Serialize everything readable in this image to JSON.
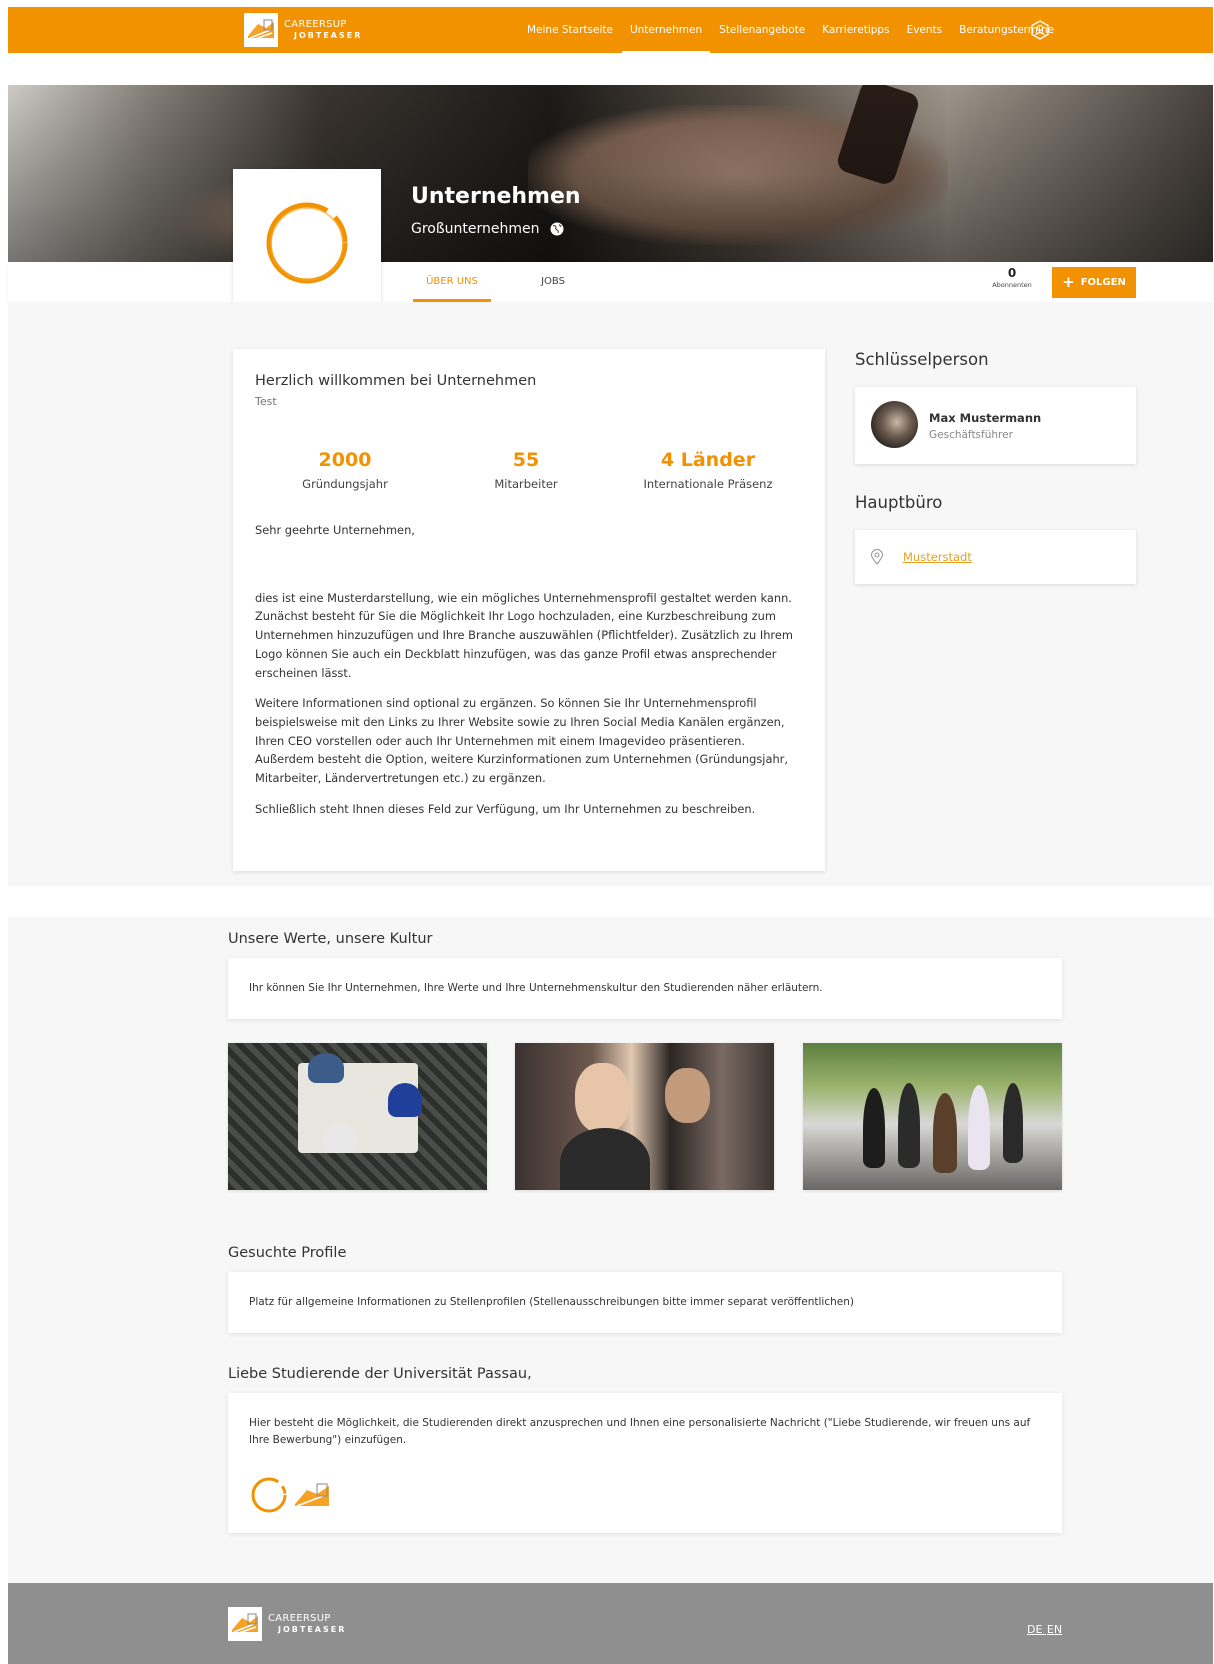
{
  "nav": {
    "logo_line1": "CAREERSUP",
    "logo_line2": "JOBTEASER",
    "links": [
      "Meine Startseite",
      "Unternehmen",
      "Stellenangebote",
      "Karrieretipps",
      "Events",
      "Beratungstermine"
    ],
    "active_link": "Unternehmen",
    "brand_color": "#f39200"
  },
  "hero": {
    "company_name": "Unternehmen",
    "company_size": "Großunternehmen"
  },
  "tabs": {
    "about": "ÜBER UNS",
    "jobs": "JOBS",
    "active": "about"
  },
  "followers": {
    "count": "0",
    "label": "Abonnenten"
  },
  "follow_button": "FOLGEN",
  "about": {
    "title": "Herzlich willkommen bei Unternehmen",
    "subtitle": "Test",
    "stats": [
      {
        "value": "2000",
        "label": "Gründungsjahr"
      },
      {
        "value": "55",
        "label": "Mitarbeiter"
      },
      {
        "value": "4 Länder",
        "label": "Internationale Präsenz"
      }
    ],
    "paragraphs": [
      "Sehr geehrte Unternehmen,",
      "dies ist eine Musterdarstellung, wie ein mögliches Unternehmensprofil gestaltet werden kann. Zunächst besteht für Sie die Möglichkeit Ihr Logo hochzuladen, eine Kurzbeschreibung zum Unternehmen hinzuzufügen und Ihre Branche auszuwählen (Pflichtfelder). Zusätzlich zu Ihrem Logo können Sie auch ein Deckblatt hinzufügen, was das ganze Profil etwas ansprechender erscheinen lässt.",
      "Weitere Informationen sind optional zu ergänzen. So können Sie Ihr Unternehmensprofil beispielsweise mit den Links zu Ihrer Website sowie zu Ihren Social Media Kanälen ergänzen, Ihren CEO vorstellen oder auch Ihr Unternehmen mit einem Imagevideo präsentieren. Außerdem besteht die Option, weitere Kurzinformationen zum Unternehmen (Gründungsjahr, Mitarbeiter, Ländervertretungen etc.) zu ergänzen.",
      "Schließlich steht Ihnen dieses Feld zur Verfügung, um Ihr Unternehmen zu beschreiben."
    ]
  },
  "key_person": {
    "heading": "Schlüsselperson",
    "name": "Max Mustermann",
    "role": "Geschäftsführer"
  },
  "office": {
    "heading": "Hauptbüro",
    "city": "Musterstadt"
  },
  "values": {
    "heading": "Unsere Werte, unsere Kultur",
    "text": "Ihr können Sie Ihr Unternehmen, Ihre Werte und Ihre Unternehmenskultur den Studierenden näher erläutern."
  },
  "profiles": {
    "heading": "Gesuchte Profile",
    "text": "Platz für allgemeine Informationen zu Stellenprofilen (Stellenausschreibungen bitte immer separat veröffentlichen)"
  },
  "students": {
    "heading": "Liebe Studierende der Universität Passau,",
    "text": "Hier besteht die Möglichkeit, die Studierenden direkt anzusprechen und Ihnen eine personalisierte Nachricht (\"Liebe Studierende, wir freuen uns auf Ihre Bewerbung\") einzufügen."
  },
  "footer": {
    "logo_line1": "CAREERSUP",
    "logo_line2": "JOBTEASER",
    "lang_de": "DE",
    "lang_en": "EN"
  }
}
